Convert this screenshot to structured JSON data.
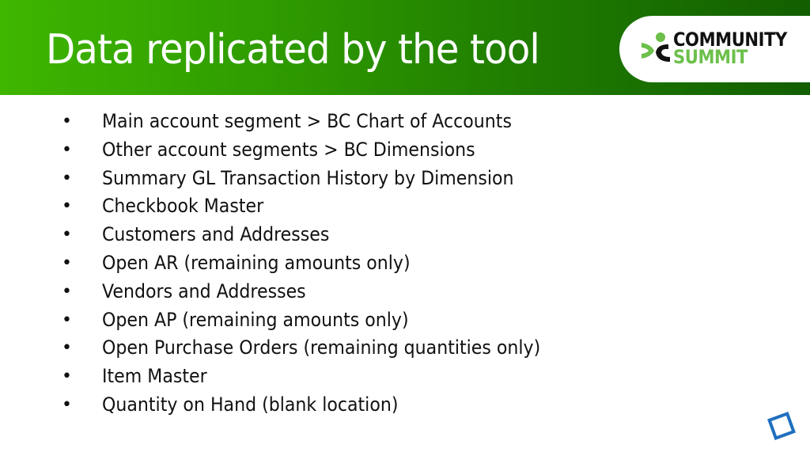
{
  "slide": {
    "title": "Data replicated by the tool",
    "logo": {
      "line1": "COMMUNITY",
      "line2": "SUMMIT",
      "colors": {
        "green": "#6cc04a",
        "black": "#111111"
      }
    },
    "header_gradient": {
      "start": "#3fb600",
      "end": "#125e00"
    },
    "bullet_glyph": "•",
    "bullets": [
      "Main account segment > BC Chart of Accounts",
      "Other account segments > BC Dimensions",
      "Summary GL Transaction History by Dimension",
      "Checkbook Master",
      "Customers and Addresses",
      "Open AR (remaining amounts only)",
      "Vendors and Addresses",
      "Open AP (remaining amounts only)",
      "Open Purchase Orders (remaining quantities only)",
      "Item Master",
      "Quantity on Hand (blank location)"
    ],
    "corner_icon": "blue-square-logo-icon"
  }
}
